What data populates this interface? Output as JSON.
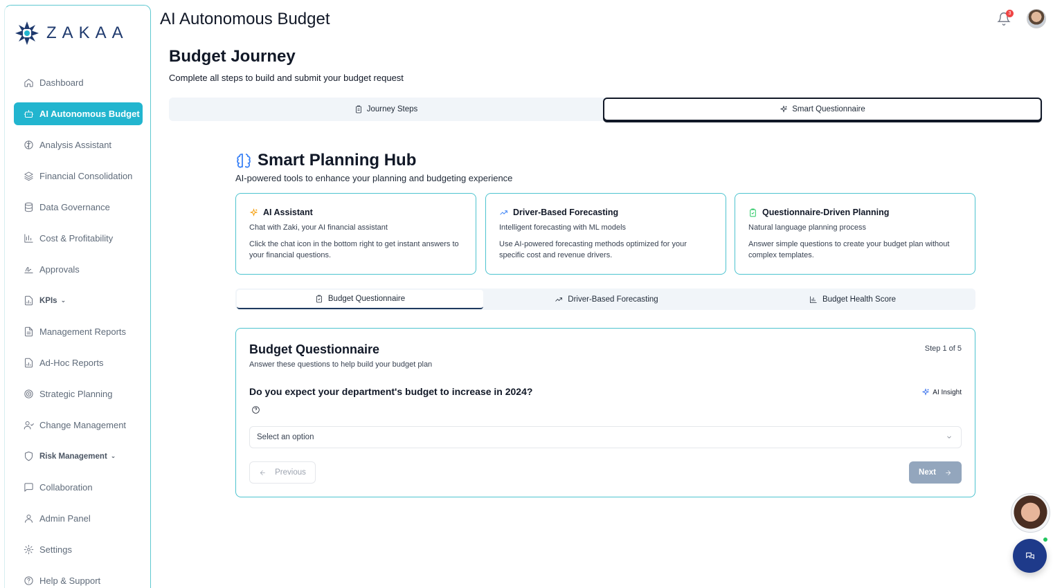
{
  "brand": {
    "wordmark": "ZAKAA"
  },
  "header": {
    "title": "AI Autonomous Budget",
    "notification_count": "3"
  },
  "sidebar": {
    "items": [
      {
        "label": "Dashboard",
        "icon": "home-icon"
      },
      {
        "label": "AI Autonomous Budget",
        "icon": "robot-icon",
        "active": true
      },
      {
        "label": "Analysis Assistant",
        "icon": "brain-icon"
      },
      {
        "label": "Financial Consolidation",
        "icon": "layers-icon"
      },
      {
        "label": "Data Governance",
        "icon": "database-icon"
      },
      {
        "label": "Cost & Profitability",
        "icon": "chart-icon"
      },
      {
        "label": "Approvals",
        "icon": "signature-icon"
      },
      {
        "label": "KPIs",
        "icon": "file-chart-icon",
        "expandable": true
      },
      {
        "label": "Management Reports",
        "icon": "document-icon"
      },
      {
        "label": "Ad-Hoc Reports",
        "icon": "file-chart-icon"
      },
      {
        "label": "Strategic Planning",
        "icon": "target-icon"
      },
      {
        "label": "Change Management",
        "icon": "users-icon"
      },
      {
        "label": "Risk Management",
        "icon": "shield-icon",
        "expandable": true
      },
      {
        "label": "Collaboration",
        "icon": "message-icon"
      },
      {
        "label": "Admin Panel",
        "icon": "user-icon"
      },
      {
        "label": "Settings",
        "icon": "gear-icon"
      },
      {
        "label": "Help & Support",
        "icon": "help-icon"
      }
    ]
  },
  "journey": {
    "title": "Budget Journey",
    "subtitle": "Complete all steps to build and submit your budget request",
    "tabs": [
      {
        "label": "Journey Steps",
        "icon": "clipboard-icon"
      },
      {
        "label": "Smart Questionnaire",
        "icon": "sparkles-icon",
        "active": true
      }
    ]
  },
  "hub": {
    "title": "Smart Planning Hub",
    "subtitle": "AI-powered tools to enhance your planning and budgeting experience",
    "cards": [
      {
        "title": "AI Assistant",
        "subtitle": "Chat with Zaki, your AI financial assistant",
        "body": "Click the chat icon in the bottom right to get instant answers to your financial questions.",
        "icon": "sparkles-icon",
        "icon_color": "#f59e0b"
      },
      {
        "title": "Driver-Based Forecasting",
        "subtitle": "Intelligent forecasting with ML models",
        "body": "Use AI-powered forecasting methods optimized for your specific cost and revenue drivers.",
        "icon": "trending-up-icon",
        "icon_color": "#3b82f6"
      },
      {
        "title": "Questionnaire-Driven Planning",
        "subtitle": "Natural language planning process",
        "body": "Answer simple questions to create your budget plan without complex templates.",
        "icon": "clipboard-check-icon",
        "icon_color": "#22c55e"
      }
    ],
    "tabs": [
      {
        "label": "Budget Questionnaire",
        "icon": "clipboard-icon",
        "active": true
      },
      {
        "label": "Driver-Based Forecasting",
        "icon": "trending-up-icon"
      },
      {
        "label": "Budget Health Score",
        "icon": "bar-chart-icon"
      }
    ]
  },
  "questionnaire": {
    "title": "Budget Questionnaire",
    "subtitle": "Answer these questions to help build your budget plan",
    "step": "Step 1 of 5",
    "question": "Do you expect your department's budget to increase in 2024?",
    "insight_label": "AI Insight",
    "select_placeholder": "Select an option",
    "prev_label": "Previous",
    "next_label": "Next"
  },
  "colors": {
    "accent": "#22b5cf",
    "card_border": "#4cc3cf",
    "chat_button": "#1e3a8a",
    "next_button": "#93a6bd"
  }
}
